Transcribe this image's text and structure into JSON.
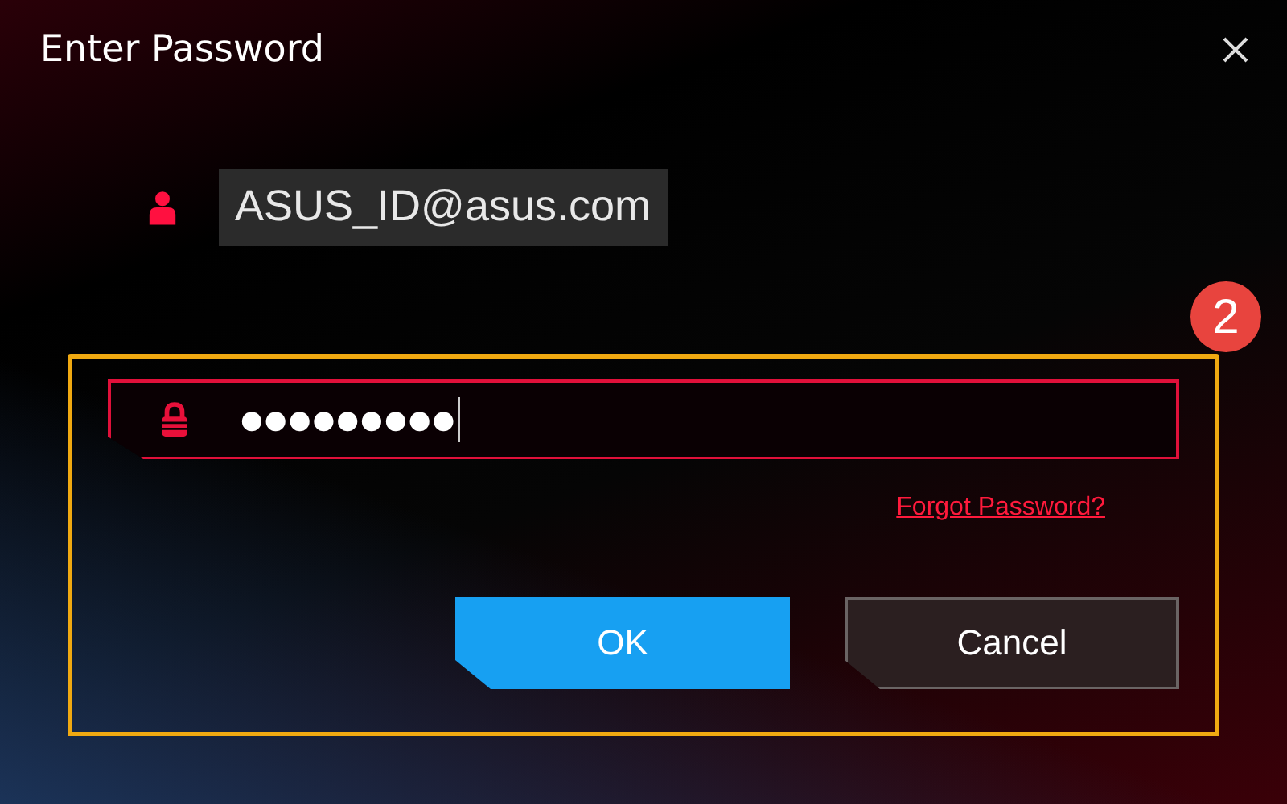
{
  "window": {
    "title": "Enter Password"
  },
  "account": {
    "value": "ASUS_ID@asus.com"
  },
  "password": {
    "value": "●●●●●●●●●",
    "focused": true
  },
  "forgot_link": "Forgot Password?",
  "buttons": [
    {
      "label": "OK",
      "kind": "primary"
    },
    {
      "label": "Cancel",
      "kind": "secondary"
    }
  ],
  "callout": {
    "label": "2"
  }
}
